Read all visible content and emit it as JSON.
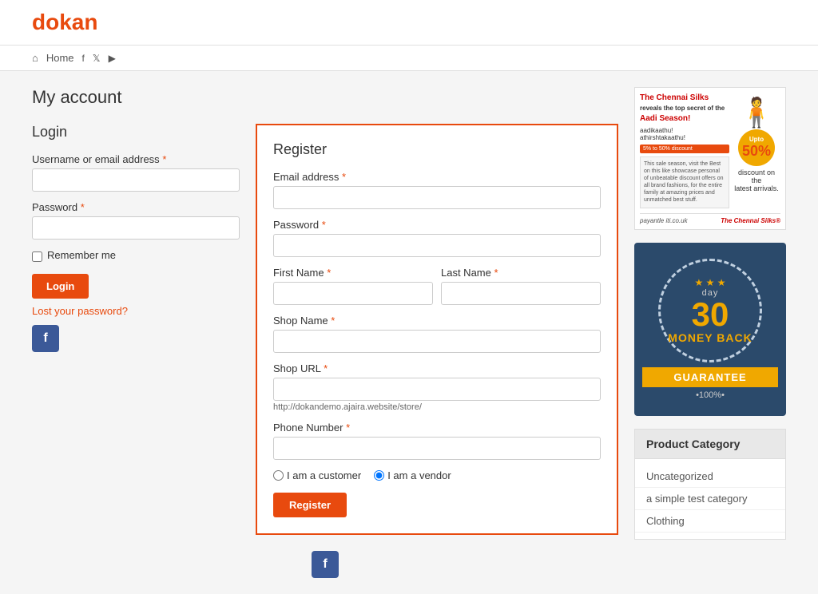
{
  "header": {
    "logo_d": "d",
    "logo_rest": "okan"
  },
  "nav": {
    "home": "Home",
    "facebook": "f",
    "twitter": "t",
    "youtube": "▶"
  },
  "page": {
    "title": "My account"
  },
  "login": {
    "section_title": "Login",
    "username_label": "Username or email address",
    "password_label": "Password",
    "remember_me": "Remember me",
    "login_btn": "Login",
    "lost_password": "Lost your password?"
  },
  "register": {
    "section_title": "Register",
    "email_label": "Email address",
    "password_label": "Password",
    "first_name_label": "First Name",
    "last_name_label": "Last Name",
    "shop_name_label": "Shop Name",
    "shop_url_label": "Shop URL",
    "shop_url_hint": "http://dokandemo.ajaira.website/store/",
    "phone_label": "Phone Number",
    "radio_customer": "I am a customer",
    "radio_vendor": "I am a vendor",
    "register_btn": "Register"
  },
  "ads": {
    "chennai_line1": "The Chennai Silks",
    "chennai_line2": "reveals the top secret of the",
    "chennai_line3": "Aadi Season!",
    "chennai_discount": "50%",
    "chennai_sub1": "discount on the",
    "chennai_sub2": "latest arrivals.",
    "guarantee_label": "day",
    "guarantee_num": "30",
    "guarantee_word": "day",
    "guarantee_text": "MONEY BACK",
    "guarantee_ribbon": "GUARANTEE",
    "guarantee_pct": "•100%•"
  },
  "sidebar": {
    "product_category_title": "Product Category",
    "categories": [
      "Uncategorized",
      "a simple test category",
      "Clothing"
    ]
  },
  "facebook_icon": "f"
}
